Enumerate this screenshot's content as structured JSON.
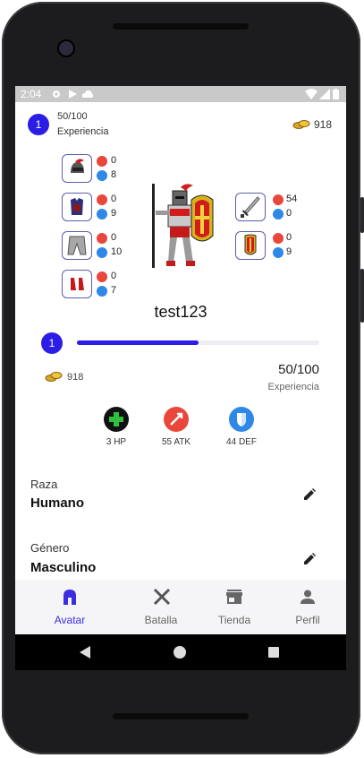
{
  "status_bar": {
    "time": "2:04"
  },
  "header": {
    "level": "1",
    "xp": "50/100",
    "xp_label": "Experiencia",
    "coins": "918"
  },
  "equipment": {
    "helmet": {
      "atk": "0",
      "def": "8"
    },
    "armor": {
      "atk": "0",
      "def": "9"
    },
    "pants": {
      "atk": "0",
      "def": "10"
    },
    "boots": {
      "atk": "0",
      "def": "7"
    },
    "weapon": {
      "atk": "54",
      "def": "0"
    },
    "shield": {
      "atk": "0",
      "def": "9"
    }
  },
  "username": "test123",
  "progress": {
    "level": "1",
    "fraction": 0.5,
    "coins": "918",
    "xp": "50/100",
    "xp_label": "Experiencia"
  },
  "stats": {
    "hp": "3 HP",
    "atk": "55 ATK",
    "def": "44 DEF"
  },
  "fields": [
    {
      "label": "Raza",
      "value": "Humano"
    },
    {
      "label": "Género",
      "value": "Masculino"
    }
  ],
  "tabs": [
    {
      "label": "Avatar",
      "active": true
    },
    {
      "label": "Batalla"
    },
    {
      "label": "Tienda"
    },
    {
      "label": "Perfil"
    }
  ],
  "colors": {
    "accent": "#2b1de5",
    "atk": "#e9463c",
    "def": "#2e88e8",
    "hp": "#1f9e30"
  }
}
